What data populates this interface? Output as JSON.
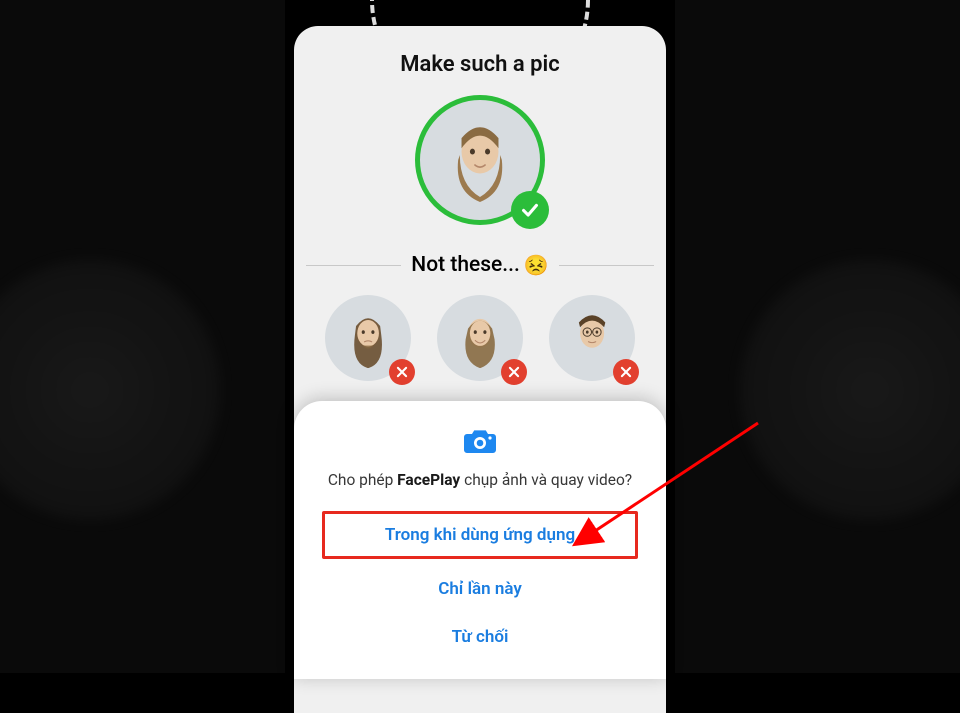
{
  "card": {
    "title": "Make such a pic",
    "not_these_label": "Not these...",
    "not_these_emoji": "😣"
  },
  "permission": {
    "prefix": "Cho phép ",
    "app_name": "FacePlay",
    "suffix": " chụp ảnh và quay video?",
    "option_while_using": "Trong khi dùng ứng dụng",
    "option_only_this_time": "Chỉ lần này",
    "option_deny": "Từ chối"
  },
  "icons": {
    "camera": "camera-icon",
    "check": "check-icon",
    "x": "x-icon"
  },
  "colors": {
    "green": "#2bbd3a",
    "red": "#e2402f",
    "blue": "#1a7de0",
    "highlight": "#e7291e"
  }
}
